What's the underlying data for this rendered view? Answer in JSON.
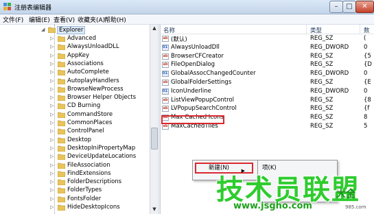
{
  "window": {
    "title": "注册表编辑器",
    "buttons": {
      "min": "–",
      "max": "□",
      "close": "✕"
    }
  },
  "menu": [
    "文件(F)",
    "编辑(E)",
    "查看(V)",
    "收藏夹(A)",
    "帮助(H)"
  ],
  "tree": {
    "parent": "Explorer",
    "items": [
      "Advanced",
      "AlwaysUnloadDLL",
      "AppKey",
      "Associations",
      "AutoComplete",
      "AutoplayHandlers",
      "BrowseNewProcess",
      "Browser Helper Objects",
      "CD Burning",
      "CommandStore",
      "CommonPlaces",
      "ControlPanel",
      "Desktop",
      "DesktopIniPropertyMap",
      "DeviceUpdateLocations",
      "FileAssociation",
      "FindExtensions",
      "FolderDescriptions",
      "FolderTypes",
      "FontsFolder",
      "HideDesktopIcons"
    ]
  },
  "list": {
    "headers": {
      "name": "名称",
      "type": "类型",
      "data": "数"
    },
    "rows": [
      {
        "name": "(默认)",
        "type": "REG_SZ",
        "data": "(",
        "icon": "sz"
      },
      {
        "name": "AlwaysUnloadDll",
        "type": "REG_DWORD",
        "data": "0",
        "icon": "dw"
      },
      {
        "name": "BrowserCFCreator",
        "type": "REG_SZ",
        "data": "{5",
        "icon": "sz"
      },
      {
        "name": "FileOpenDialog",
        "type": "REG_SZ",
        "data": "{D",
        "icon": "sz"
      },
      {
        "name": "GlobalAssocChangedCounter",
        "type": "REG_DWORD",
        "data": "0",
        "icon": "dw"
      },
      {
        "name": "GlobalFolderSettings",
        "type": "REG_SZ",
        "data": "{E",
        "icon": "sz"
      },
      {
        "name": "IconUnderline",
        "type": "REG_DWORD",
        "data": "0",
        "icon": "dw"
      },
      {
        "name": "ListViewPopupControl",
        "type": "REG_SZ",
        "data": "{8",
        "icon": "sz"
      },
      {
        "name": "LVPopupSearchControl",
        "type": "REG_SZ",
        "data": "{f",
        "icon": "sz"
      },
      {
        "name": "Max Cached Icons",
        "type": "REG_SZ",
        "data": "8",
        "icon": "sz"
      },
      {
        "name": "MaxCachedTiles",
        "type": "REG_SZ",
        "data": "5",
        "icon": "sz"
      }
    ]
  },
  "context_menu": {
    "item": "新建(N)",
    "arrow": "▶",
    "submenu_item": "项(K)"
  },
  "watermark": {
    "main": "技术员联盟",
    "side": "大全",
    "url": "www.jsgho.com",
    "num": "985.com"
  }
}
